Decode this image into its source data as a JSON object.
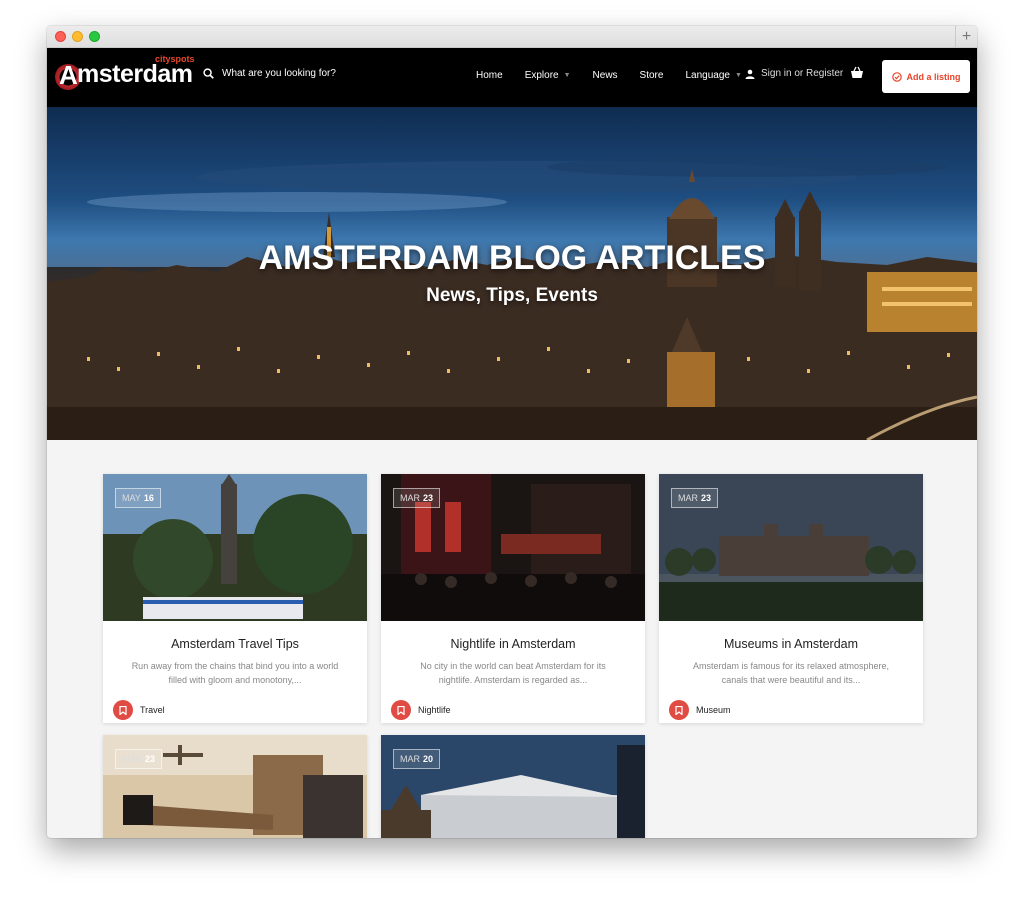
{
  "window": {
    "new_tab": "+"
  },
  "nav": {
    "logo_main": "msterdam",
    "logo_letter": "A",
    "logo_sub": "cityspots",
    "search_placeholder": "What are you looking for?",
    "menu": [
      {
        "label": "Home"
      },
      {
        "label": "Explore",
        "has_dropdown": true
      },
      {
        "label": "News"
      },
      {
        "label": "Store"
      },
      {
        "label": "Language",
        "has_dropdown": true
      }
    ],
    "signin": "Sign in or Register",
    "add_listing": "Add a listing"
  },
  "hero": {
    "title": "AMSTERDAM BLOG ARTICLES",
    "subtitle": "News, Tips, Events"
  },
  "cards": [
    {
      "month": "MAY",
      "day": "16",
      "title": "Amsterdam Travel Tips",
      "desc": "Run away from the chains that bind you into a world filled with gloom and monotony,...",
      "category": "Travel"
    },
    {
      "month": "MAR",
      "day": "23",
      "title": "Nightlife in Amsterdam",
      "desc": "No city in the world can beat Amsterdam for its nightlife. Amsterdam is regarded as...",
      "category": "Nightlife"
    },
    {
      "month": "MAR",
      "day": "23",
      "title": "Museums in Amsterdam",
      "desc": "Amsterdam is famous for its relaxed atmosphere, canals that were beautiful and its...",
      "category": "Museum"
    },
    {
      "month": "MAR",
      "day": "23"
    },
    {
      "month": "MAR",
      "day": "20"
    }
  ],
  "colors": {
    "accent": "#e8452c",
    "category_icon": "#e04b43",
    "nav_bg": "#000000"
  }
}
